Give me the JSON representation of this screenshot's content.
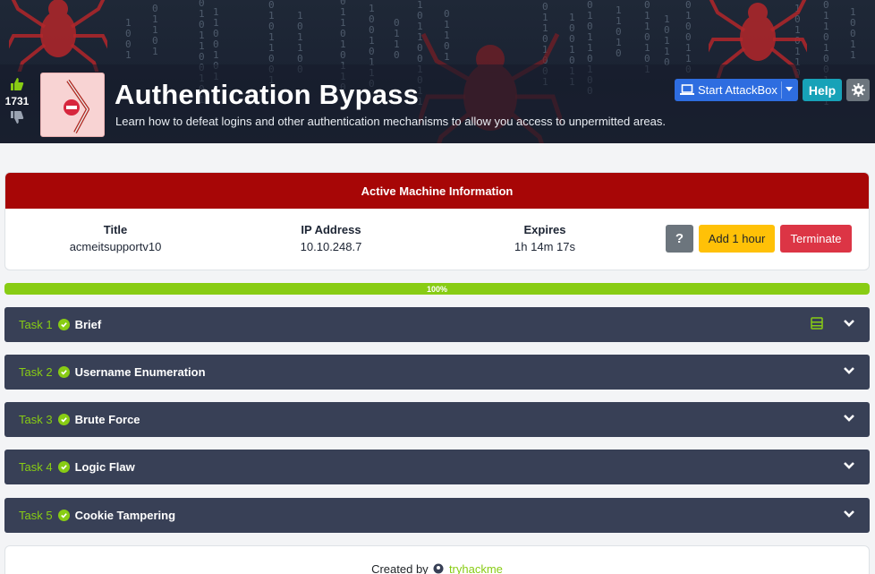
{
  "room": {
    "votes": "1731",
    "title": "Authentication Bypass",
    "description": "Learn how to defeat logins and other authentication mechanisms to allow you access to unpermitted areas.",
    "start_attackbox_label": "Start AttackBox",
    "help_label": "Help"
  },
  "machine": {
    "header": "Active Machine Information",
    "title_label": "Title",
    "title_value": "acmeitsupportv10",
    "ip_label": "IP Address",
    "ip_value": "10.10.248.7",
    "expires_label": "Expires",
    "expires_value": "1h 14m 17s",
    "help_button": "?",
    "add_hour_label": "Add 1 hour",
    "terminate_label": "Terminate"
  },
  "progress": {
    "value": 100,
    "label": "100%"
  },
  "tasks": [
    {
      "number": "Task 1",
      "name": "Brief"
    },
    {
      "number": "Task 2",
      "name": "Username Enumeration"
    },
    {
      "number": "Task 3",
      "name": "Brute Force"
    },
    {
      "number": "Task 4",
      "name": "Logic Flaw"
    },
    {
      "number": "Task 5",
      "name": "Cookie Tampering"
    }
  ],
  "footer": {
    "created_by": "Created by",
    "author": "tryhackme"
  },
  "colors": {
    "accent_green": "#88cc14",
    "machine_header": "#a70606",
    "task_bg": "#384056"
  },
  "icons": [
    "thumbs-up-icon",
    "thumbs-down-icon",
    "no-entry-icon",
    "laptop-icon",
    "gear-icon",
    "check-circle-icon",
    "chevron-down-icon",
    "server-icon"
  ]
}
